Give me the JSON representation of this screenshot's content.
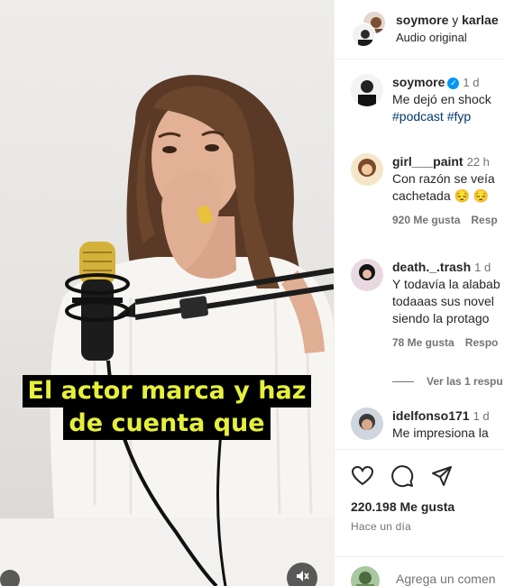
{
  "video": {
    "caption_line1": "El actor marca y haz",
    "caption_line2": "de cuenta que",
    "caption_color": "#e6f03a",
    "mute_icon": "speaker-muted-icon"
  },
  "header": {
    "user1": "soymore",
    "joiner": "y",
    "user2": "karlae",
    "subtitle": "Audio original"
  },
  "comments": [
    {
      "username": "soymore",
      "verified": true,
      "time": "1 d",
      "text_line1": "Me dejó en shock",
      "hashtags": "#podcast #fyp"
    },
    {
      "username": "girl___paint",
      "time": "22 h",
      "text_line1": "Con razón se veía",
      "text_line2": "cachetada 😔 😔",
      "likes": "920 Me gusta",
      "reply": "Resp"
    },
    {
      "username": "death._.trash",
      "time": "1 d",
      "text_line1": "Y todavía la alabab",
      "text_line2": "todaaas sus novel",
      "text_line3": "siendo la protago",
      "likes": "78 Me gusta",
      "reply": "Respo"
    },
    {
      "username": "idelfonso171",
      "time": "1 d",
      "text_line1": "Me impresiona la"
    }
  ],
  "view_replies": "Ver las 1 respu",
  "actions": {
    "like_count": "220.198 Me gusta",
    "posted": "Hace un día",
    "add_comment_placeholder": "Agrega un comen"
  },
  "colors": {
    "link": "#00376b",
    "verified": "#0095f6",
    "muted_text": "#737373"
  }
}
